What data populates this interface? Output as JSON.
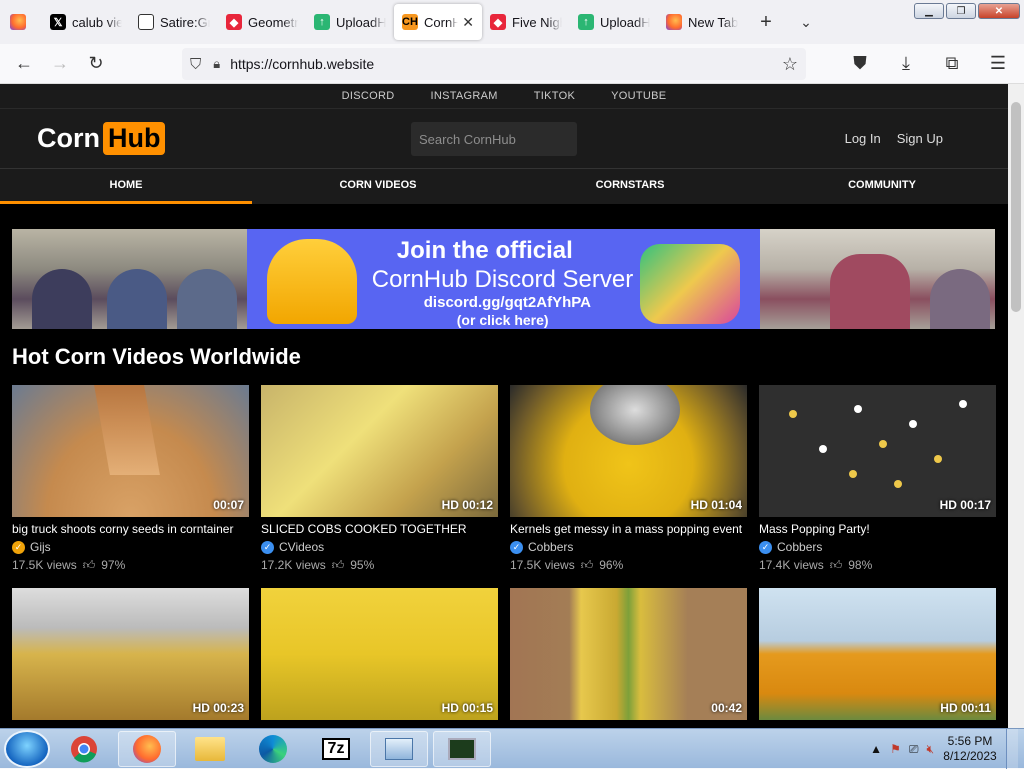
{
  "browser": {
    "tabs": [
      {
        "title": "",
        "favicon": "firefox-icon"
      },
      {
        "title": "calub vie",
        "favicon": "x-icon"
      },
      {
        "title": "Satire:Gra",
        "favicon": "satire-icon"
      },
      {
        "title": "Geometry",
        "favicon": "geometry-icon"
      },
      {
        "title": "UploadHa",
        "favicon": "upload-icon"
      },
      {
        "title": "CornH",
        "favicon": "ch-icon",
        "active": true
      },
      {
        "title": "Five Nigh",
        "favicon": "geometry-icon"
      },
      {
        "title": "UploadHa",
        "favicon": "upload-icon"
      },
      {
        "title": "New Tab",
        "favicon": "firefox-icon"
      }
    ],
    "ch_favicon_text": "CH",
    "url": "https://cornhub.website"
  },
  "site": {
    "social_links": [
      "DISCORD",
      "INSTAGRAM",
      "TIKTOK",
      "YOUTUBE"
    ],
    "logo_left": "Corn",
    "logo_right": "Hub",
    "search_placeholder": "Search CornHub",
    "login": "Log In",
    "signup": "Sign Up",
    "nav": [
      "HOME",
      "CORN VIDEOS",
      "CORNSTARS",
      "COMMUNITY"
    ],
    "nav_active": "HOME",
    "banner": {
      "line1": "Join the official",
      "line2": "CornHub Discord Server",
      "line3": "discord.gg/gqt2AfYhPA",
      "line4": "(or click here)"
    },
    "section_title": "Hot Corn Videos Worldwide",
    "videos": [
      {
        "title": "big truck shoots corny seeds in corntainer",
        "channel": "Gijs",
        "badge": "orange",
        "views": "17.5K views",
        "rating": "97%",
        "duration": "00:07"
      },
      {
        "title": "SLICED COBS COOKED TOGETHER",
        "channel": "CVideos",
        "badge": "blue",
        "views": "17.2K views",
        "rating": "95%",
        "duration": "HD 00:12"
      },
      {
        "title": "Kernels get messy in a mass popping event",
        "channel": "Cobbers",
        "badge": "blue",
        "views": "17.5K views",
        "rating": "96%",
        "duration": "HD 01:04"
      },
      {
        "title": "Mass Popping Party!",
        "channel": "Cobbers",
        "badge": "blue",
        "views": "17.4K views",
        "rating": "98%",
        "duration": "HD 00:17"
      },
      {
        "duration": "HD 00:23"
      },
      {
        "duration": "HD 00:15"
      },
      {
        "duration": "00:42"
      },
      {
        "duration": "HD 00:11"
      }
    ]
  },
  "taskbar": {
    "time": "5:56 PM",
    "date": "8/12/2023",
    "seven_zip": "7z"
  }
}
